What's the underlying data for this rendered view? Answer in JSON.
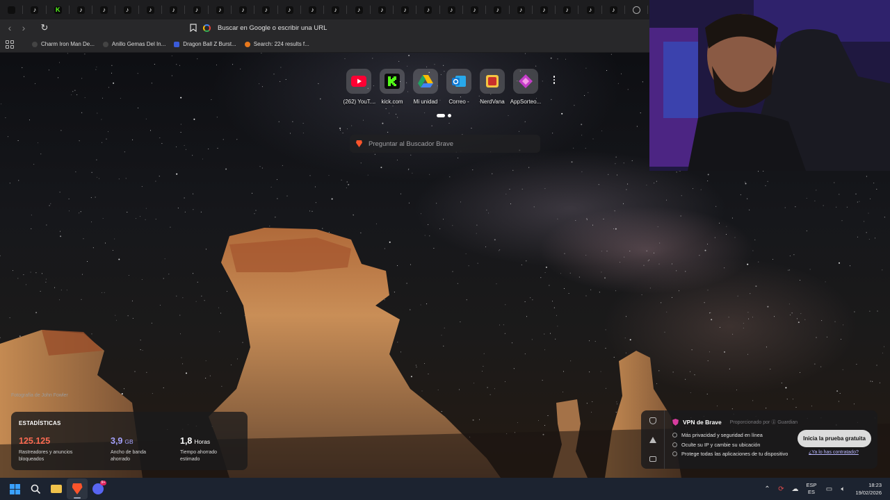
{
  "browser": {
    "tabs": [
      {
        "icon": "app-icon",
        "label": "",
        "kind": "plain"
      },
      {
        "icon": "tiktok-icon",
        "label": "",
        "kind": "tt"
      },
      {
        "icon": "kick-icon",
        "label": "K",
        "kind": "kick"
      },
      {
        "icon": "tiktok-icon",
        "label": "",
        "kind": "tt"
      },
      {
        "icon": "tiktok-icon",
        "label": "",
        "kind": "tt"
      },
      {
        "icon": "tiktok-icon",
        "label": "",
        "kind": "tt"
      },
      {
        "icon": "tiktok-icon",
        "label": "",
        "kind": "tt"
      },
      {
        "icon": "tiktok-icon",
        "label": "",
        "kind": "tt"
      },
      {
        "icon": "tiktok-icon",
        "label": "",
        "kind": "tt"
      },
      {
        "icon": "tiktok-icon",
        "label": "",
        "kind": "tt"
      },
      {
        "icon": "tiktok-icon",
        "label": "",
        "kind": "tt"
      },
      {
        "icon": "tiktok-icon",
        "label": "",
        "kind": "tt"
      },
      {
        "icon": "tiktok-icon",
        "label": "",
        "kind": "tt"
      },
      {
        "icon": "tiktok-icon",
        "label": "",
        "kind": "tt"
      },
      {
        "icon": "tiktok-icon",
        "label": "",
        "kind": "tt"
      },
      {
        "icon": "tiktok-icon",
        "label": "",
        "kind": "tt"
      },
      {
        "icon": "tiktok-icon",
        "label": "",
        "kind": "tt"
      },
      {
        "icon": "tiktok-icon",
        "label": "",
        "kind": "tt"
      },
      {
        "icon": "tiktok-icon",
        "label": "",
        "kind": "tt"
      },
      {
        "icon": "tiktok-icon",
        "label": "",
        "kind": "tt"
      },
      {
        "icon": "tiktok-icon",
        "label": "",
        "kind": "tt"
      },
      {
        "icon": "tiktok-icon",
        "label": "",
        "kind": "tt"
      },
      {
        "icon": "tiktok-icon",
        "label": "",
        "kind": "tt"
      },
      {
        "icon": "tiktok-icon",
        "label": "",
        "kind": "tt"
      },
      {
        "icon": "tiktok-icon",
        "label": "",
        "kind": "tt"
      },
      {
        "icon": "tiktok-icon",
        "label": "",
        "kind": "tt"
      },
      {
        "icon": "tiktok-icon",
        "label": "",
        "kind": "tt"
      },
      {
        "icon": "globe-icon",
        "label": "",
        "kind": "globe"
      }
    ],
    "address_bar": {
      "placeholder": "Buscar en Google o escribir una URL"
    },
    "bookmarks": [
      {
        "label": "Charm Iron Man De...",
        "icon": "favicon-icon"
      },
      {
        "label": "Anillo Gemas Del In...",
        "icon": "favicon-icon"
      },
      {
        "label": "Dragon Ball Z Burst...",
        "icon": "dragonball-icon"
      },
      {
        "label": "Search: 224 results f...",
        "icon": "search-favicon-icon"
      }
    ]
  },
  "new_tab": {
    "top_sites": [
      {
        "label": "(262) YouT...",
        "icon": "youtube-icon",
        "color": "#ff0033"
      },
      {
        "label": "kick.com",
        "icon": "kick-icon",
        "color": "#53fc18"
      },
      {
        "label": "Mi unidad",
        "icon": "google-drive-icon",
        "color": "#1fa463"
      },
      {
        "label": "Correo -",
        "icon": "outlook-icon",
        "color": "#0f78d4"
      },
      {
        "label": "NerdVana",
        "icon": "nerdvana-icon",
        "color": "#c9302c"
      },
      {
        "label": "AppSorteo...",
        "icon": "appsorteo-icon",
        "color": "#c43dc8"
      }
    ],
    "search_placeholder": "Preguntar al Buscador Brave",
    "photo_credit": "Fotografía de John Fowler",
    "stats": {
      "title": "ESTADÍSTICAS",
      "items": [
        {
          "value": "125.125",
          "unit": "",
          "desc1": "Rastreadores y anuncios",
          "desc2": "bloqueados"
        },
        {
          "value": "3,9",
          "unit": "GB",
          "desc1": "Ancho de banda",
          "desc2": "ahorrado"
        },
        {
          "value": "1,8",
          "unit": "Horas",
          "desc1": "Tiempo ahorrado",
          "desc2": "estimado"
        }
      ]
    },
    "vpn": {
      "title": "VPN de Brave",
      "provider": "Proporcionado por ⓖ Guardian",
      "features": [
        "Más privacidad y seguridad en línea",
        "Oculte su IP y cambie su ubicación",
        "Protege todas las aplicaciones de tu dispositivo"
      ],
      "cta": "Inicia la prueba gratuita",
      "link": "¿Ya lo has contratado?"
    }
  },
  "taskbar": {
    "apps": [
      "windows-start-icon",
      "search-icon",
      "file-explorer-icon",
      "brave-icon",
      "discord-icon"
    ],
    "discord_badge": "9+",
    "language": {
      "line1": "ESP",
      "line2": "ES"
    },
    "time": "18:23",
    "date": "19/02/2026"
  },
  "accent": {
    "brave": "#fb542b",
    "stats_red": "#fb6a52",
    "stats_purple": "#a6a3ff"
  }
}
